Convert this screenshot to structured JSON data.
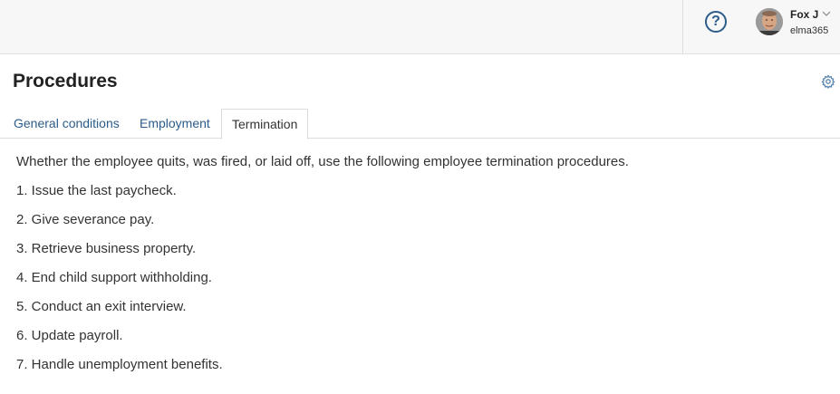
{
  "header": {
    "help_label": "?",
    "user": {
      "name": "Fox J",
      "company": "elma365"
    }
  },
  "page": {
    "title": "Procedures"
  },
  "tabs": [
    {
      "label": "General conditions",
      "active": false
    },
    {
      "label": "Employment",
      "active": false
    },
    {
      "label": "Termination",
      "active": true
    }
  ],
  "content": {
    "intro": "Whether the employee quits, was fired, or laid off, use the following employee termination procedures.",
    "steps": [
      "1. Issue the last paycheck.",
      "2. Give severance pay.",
      "3. Retrieve business property.",
      "4. End child support withholding.",
      "5. Conduct an exit interview.",
      "6. Update payroll.",
      "7. Handle unemployment benefits."
    ]
  },
  "colors": {
    "link": "#2b5c8a",
    "text": "#333333",
    "topbar_bg": "#f7f7f7",
    "border": "#dcdcdc"
  },
  "icons": {
    "help": "question-circle-icon",
    "chevron": "chevron-down-icon",
    "settings": "gear-icon",
    "avatar": "user-avatar-photo"
  }
}
